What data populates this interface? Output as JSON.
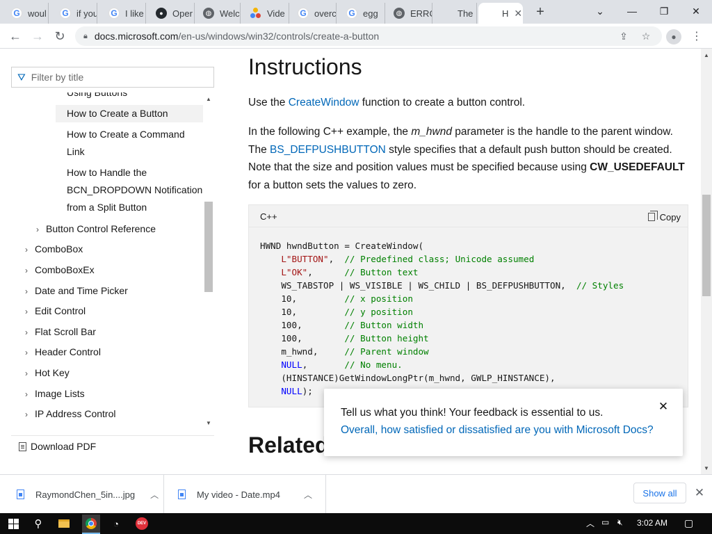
{
  "browser": {
    "tabs": [
      {
        "favicon": "google-icon",
        "title": "woul"
      },
      {
        "favicon": "google-icon",
        "title": "if you"
      },
      {
        "favicon": "google-icon",
        "title": "I like"
      },
      {
        "favicon": "github-icon",
        "title": "Oper"
      },
      {
        "favicon": "globe-icon",
        "title": "Welc"
      },
      {
        "favicon": "video-icon",
        "title": "Vide"
      },
      {
        "favicon": "google-icon",
        "title": "overc"
      },
      {
        "favicon": "google-icon",
        "title": "egg"
      },
      {
        "favicon": "globe-icon",
        "title": "ERRC"
      },
      {
        "favicon": "microsoft-icon",
        "title": "The"
      },
      {
        "favicon": "microsoft-icon",
        "title": "H",
        "active": true
      }
    ],
    "new_tab_glyph": "+",
    "url_host": "docs.microsoft.com",
    "url_path": "/en-us/windows/win32/controls/create-a-button"
  },
  "sidebar": {
    "filter_placeholder": "Filter by title",
    "items": [
      {
        "label": "Using Buttons"
      },
      {
        "label": "How to Create a Button"
      },
      {
        "label": "How to Create a Command Link"
      },
      {
        "label": "How to Handle the BCN_DROPDOWN Notification from a Split Button"
      },
      {
        "label": "Button Control Reference"
      },
      {
        "label": "ComboBox"
      },
      {
        "label": "ComboBoxEx"
      },
      {
        "label": "Date and Time Picker"
      },
      {
        "label": "Edit Control"
      },
      {
        "label": "Flat Scroll Bar"
      },
      {
        "label": "Header Control"
      },
      {
        "label": "Hot Key"
      },
      {
        "label": "Image Lists"
      },
      {
        "label": "IP Address Control"
      }
    ],
    "download_pdf": "Download PDF"
  },
  "content": {
    "heading": "Instructions",
    "p1": {
      "before": "Use the ",
      "link": "CreateWindow",
      "after": " function to create a button control."
    },
    "p2": {
      "t1": "In the following C++ example, the ",
      "em": "m_hwnd",
      "t2": " parameter is the handle to the parent window. The ",
      "link": "BS_DEFPUSHBUTTON",
      "t3": " style specifies that a default push button should be created. Note that the size and position values must be specified because using ",
      "strong": "CW_USEDEFAULT",
      "t4": " for a button sets the values to zero."
    },
    "code_lang": "C++",
    "copy_label": "Copy",
    "code_lines": [
      [
        {
          "t": "HWND hwndButton = CreateWindow("
        }
      ],
      [
        {
          "t": "    "
        },
        {
          "t": "L\"BUTTON\"",
          "c": "str"
        },
        {
          "t": ",  "
        },
        {
          "t": "// Predefined class; Unicode assumed",
          "c": "cmt"
        }
      ],
      [
        {
          "t": "    "
        },
        {
          "t": "L\"OK\"",
          "c": "str"
        },
        {
          "t": ",      "
        },
        {
          "t": "// Button text",
          "c": "cmt"
        }
      ],
      [
        {
          "t": "    WS_TABSTOP | WS_VISIBLE | WS_CHILD | BS_DEFPUSHBUTTON,  "
        },
        {
          "t": "// Styles",
          "c": "cmt"
        }
      ],
      [
        {
          "t": "    10,         "
        },
        {
          "t": "// x position",
          "c": "cmt"
        }
      ],
      [
        {
          "t": "    10,         "
        },
        {
          "t": "// y position",
          "c": "cmt"
        }
      ],
      [
        {
          "t": "    100,        "
        },
        {
          "t": "// Button width",
          "c": "cmt"
        }
      ],
      [
        {
          "t": "    100,        "
        },
        {
          "t": "// Button height",
          "c": "cmt"
        }
      ],
      [
        {
          "t": "    m_hwnd,     "
        },
        {
          "t": "// Parent window",
          "c": "cmt"
        }
      ],
      [
        {
          "t": "    "
        },
        {
          "t": "NULL",
          "c": "kw"
        },
        {
          "t": ",       "
        },
        {
          "t": "// No menu.",
          "c": "cmt"
        }
      ],
      [
        {
          "t": "    (HINSTANCE)GetWindowLongPtr(m_hwnd, GWLP_HINSTANCE),"
        }
      ],
      [
        {
          "t": "    "
        },
        {
          "t": "NULL",
          "c": "kw"
        },
        {
          "t": ");"
        }
      ]
    ],
    "heading2": "Related"
  },
  "feedback": {
    "line1": "Tell us what you think! Your feedback is essential to us.",
    "line2": "Overall, how satisfied or dissatisfied are you with Microsoft Docs?"
  },
  "downloads": {
    "items": [
      {
        "name": "RaymondChen_5in....jpg"
      },
      {
        "name": "My video - Date.mp4"
      }
    ],
    "show_all": "Show all"
  },
  "taskbar": {
    "time": "3:02 AM",
    "dev_label": "DEV"
  },
  "colors": {
    "accent": "#0067b8",
    "code_bg": "#f2f2f2",
    "string": "#a31515",
    "comment": "#008000"
  }
}
